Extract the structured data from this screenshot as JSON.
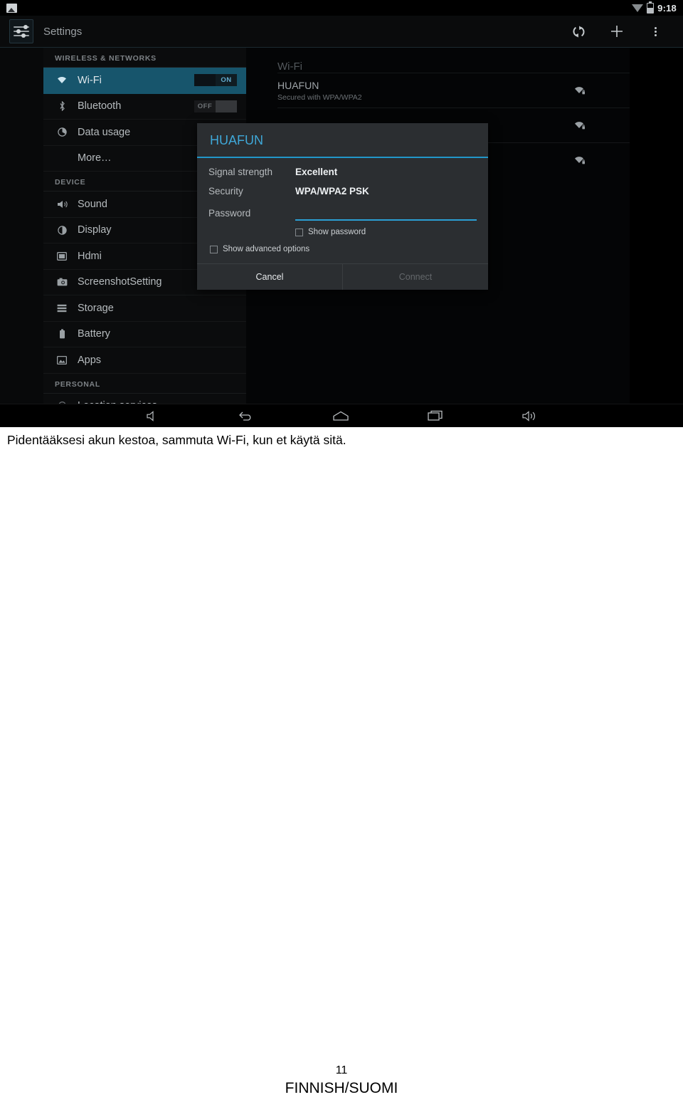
{
  "statusbar": {
    "app_icon": "gallery-icon",
    "wifi_icon": "wifi-signal-icon",
    "battery_icon": "battery-icon",
    "time": "9:18"
  },
  "actionbar": {
    "launcher_icon": "settings-sliders-icon",
    "title": "Settings",
    "scan_icon": "refresh-scan-icon",
    "add_icon": "add-plus-icon",
    "overflow_icon": "overflow-menu-icon"
  },
  "sidebar": {
    "sections": [
      {
        "header": "WIRELESS & NETWORKS",
        "items": [
          {
            "label": "Wi-Fi",
            "icon": "wifi-icon",
            "active": true,
            "toggle": "ON",
            "toggle_state": "on"
          },
          {
            "label": "Bluetooth",
            "icon": "bluetooth-icon",
            "active": false,
            "toggle": "OFF",
            "toggle_state": "off"
          },
          {
            "label": "Data usage",
            "icon": "data-usage-icon",
            "active": false
          },
          {
            "label": "More…",
            "icon": null,
            "active": false
          }
        ]
      },
      {
        "header": "DEVICE",
        "items": [
          {
            "label": "Sound",
            "icon": "sound-icon",
            "active": false
          },
          {
            "label": "Display",
            "icon": "display-icon",
            "active": false
          },
          {
            "label": "Hdmi",
            "icon": "hdmi-icon",
            "active": false
          },
          {
            "label": "ScreenshotSetting",
            "icon": "camera-icon",
            "active": false
          },
          {
            "label": "Storage",
            "icon": "storage-icon",
            "active": false
          },
          {
            "label": "Battery",
            "icon": "battery-icon",
            "active": false
          },
          {
            "label": "Apps",
            "icon": "apps-icon",
            "active": false
          }
        ]
      },
      {
        "header": "PERSONAL",
        "items": [
          {
            "label": "Location services",
            "icon": "location-icon",
            "active": false,
            "clipped": true
          }
        ]
      }
    ]
  },
  "wifi_pane": {
    "title": "Wi-Fi",
    "networks": [
      {
        "ssid": "HUAFUN",
        "status": "Secured with WPA/WPA2",
        "icon": "wifi-secured-icon"
      },
      {
        "ssid": "",
        "status": "",
        "icon": "wifi-secured-icon"
      },
      {
        "ssid": "",
        "status": "",
        "icon": "wifi-secured-icon"
      }
    ]
  },
  "dialog": {
    "title": "HUAFUN",
    "signal_strength_label": "Signal strength",
    "signal_strength_value": "Excellent",
    "security_label": "Security",
    "security_value": "WPA/WPA2 PSK",
    "password_label": "Password",
    "password_value": "",
    "password_placeholder": "",
    "show_password_label": "Show password",
    "show_password_checked": false,
    "show_advanced_label": "Show advanced options",
    "show_advanced_checked": false,
    "cancel_label": "Cancel",
    "connect_label": "Connect",
    "connect_disabled": true,
    "accent_color": "#2196c9"
  },
  "navbar": {
    "buttons": [
      {
        "name": "volume-down-icon"
      },
      {
        "name": "back-icon"
      },
      {
        "name": "home-icon"
      },
      {
        "name": "recents-icon"
      },
      {
        "name": "volume-up-icon"
      }
    ]
  },
  "caption": "Pidentääksesi akun kestoa, sammuta Wi-Fi, kun et käytä sitä.",
  "footer": {
    "page_number": "11",
    "language": "FINNISH/SUOMI"
  }
}
